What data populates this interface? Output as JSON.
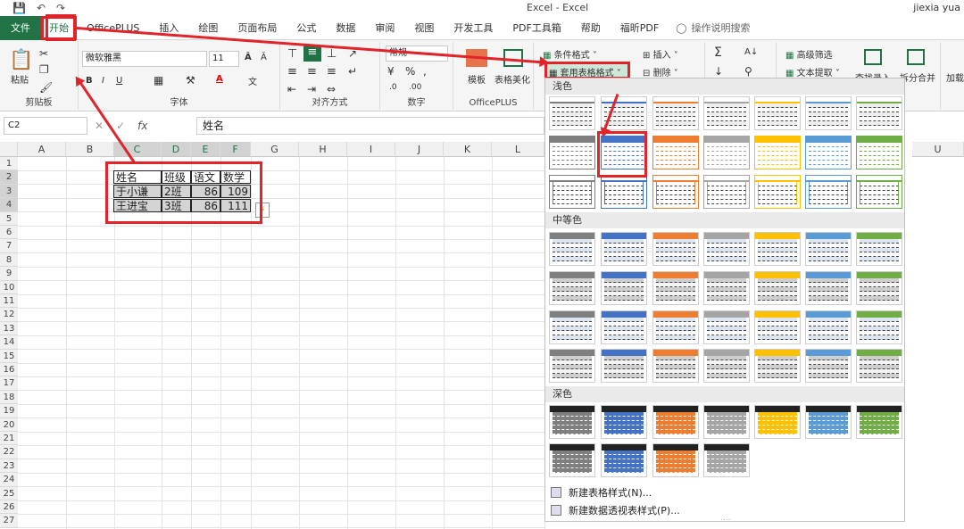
{
  "window": {
    "title": "Excel - Excel",
    "user": "jiexia yua"
  },
  "tabs": [
    "文件",
    "开始",
    "OfficePLUS",
    "插入",
    "绘图",
    "页面布局",
    "公式",
    "数据",
    "审阅",
    "视图",
    "开发工具",
    "PDF工具箱",
    "帮助",
    "福昕PDF"
  ],
  "tell": "操作说明搜索",
  "ribbon": {
    "paste": "粘贴",
    "clipboard": "剪贴板",
    "font_name": "微软雅黑",
    "font_size": "11",
    "font_group": "字体",
    "align_group": "对齐方式",
    "number_format": "常规",
    "number_group": "数字",
    "template": "模板",
    "beautify": "表格美化",
    "officeplus_group": "OfficePLUS",
    "cond_format": "条件格式",
    "table_format": "套用表格格式",
    "insert": "插入",
    "delete": "删除",
    "adv_filter": "高级筛选",
    "text_extract": "文本提取",
    "find_enter": "查找录入",
    "merge_split": "拆分合并",
    "load": "加载"
  },
  "formula": {
    "cell": "C2",
    "fx": "fx",
    "value": "姓名"
  },
  "columns": [
    "A",
    "B",
    "C",
    "D",
    "E",
    "F",
    "G",
    "H",
    "I",
    "J",
    "K",
    "L",
    "U"
  ],
  "rows": [
    "1",
    "2",
    "3",
    "4",
    "5",
    "6",
    "7",
    "8",
    "9",
    "10",
    "11",
    "12",
    "13",
    "14",
    "15",
    "16",
    "17",
    "18",
    "19",
    "20",
    "21",
    "22",
    "23",
    "24",
    "25",
    "26",
    "27"
  ],
  "table": {
    "headers": [
      "姓名",
      "班级",
      "语文",
      "数学"
    ],
    "rows": [
      [
        "于小谦",
        "2班",
        "86",
        "109"
      ],
      [
        "王进宝",
        "3班",
        "86",
        "111"
      ]
    ]
  },
  "gallery": {
    "light": "浅色",
    "medium": "中等色",
    "dark": "深色",
    "new_table_style": "新建表格样式(N)...",
    "new_pivot_style": "新建数据透视表样式(P)...",
    "colors": [
      "#7f7f7f",
      "#4472c4",
      "#ed7d31",
      "#a5a5a5",
      "#ffc000",
      "#5b9bd5",
      "#70ad47"
    ]
  }
}
